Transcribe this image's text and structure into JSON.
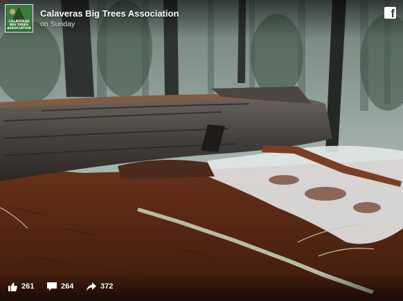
{
  "post": {
    "page_name": "Calaveras Big Trees Association",
    "timestamp": "on Sunday",
    "logo_text": "CALAVERAS BIG TREES ASSOCIATION",
    "brand_icon": "facebook-icon",
    "image_subject": "fallen-giant-sequoia-log-in-snowy-forest"
  },
  "stats": {
    "likes": "261",
    "comments": "264",
    "shares": "372",
    "icons": [
      "like-thumb-icon",
      "comment-bubble-icon",
      "share-arrow-icon"
    ]
  },
  "colors": {
    "text": "#ffffff",
    "logo_bg": "#2f6a35",
    "soil": "#5a2a16",
    "snow": "#e9ecef",
    "fog": "#9fb0ac"
  }
}
